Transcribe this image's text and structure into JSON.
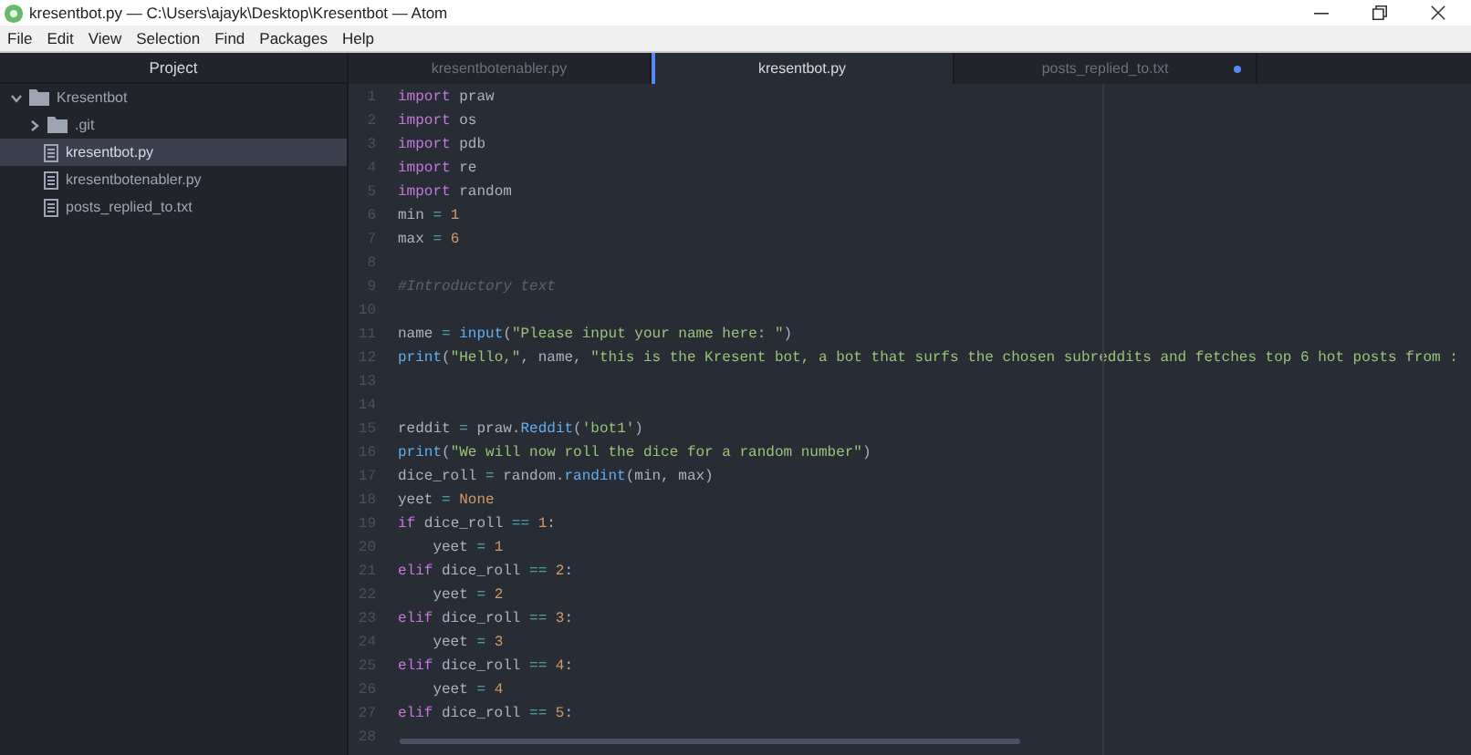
{
  "window": {
    "title": "kresentbot.py — C:\\Users\\ajayk\\Desktop\\Kresentbot — Atom"
  },
  "menu": [
    "File",
    "Edit",
    "View",
    "Selection",
    "Find",
    "Packages",
    "Help"
  ],
  "sidebar": {
    "title": "Project",
    "tree": [
      {
        "label": "Kresentbot",
        "kind": "folder",
        "expanded": true,
        "selected": false,
        "children": [
          {
            "label": ".git",
            "kind": "folder",
            "expanded": false,
            "selected": false
          },
          {
            "label": "kresentbot.py",
            "kind": "file",
            "selected": true
          },
          {
            "label": "kresentbotenabler.py",
            "kind": "file",
            "selected": false
          },
          {
            "label": "posts_replied_to.txt",
            "kind": "file",
            "selected": false
          }
        ]
      }
    ]
  },
  "tabs": [
    {
      "label": "kresentbotenabler.py",
      "selected": false,
      "modified": false
    },
    {
      "label": "kresentbot.py",
      "selected": true,
      "modified": false
    },
    {
      "label": "posts_replied_to.txt",
      "selected": false,
      "modified": true
    }
  ],
  "editor": {
    "lines": [
      {
        "number": "1",
        "tokens": [
          {
            "text": "import",
            "kind": "keyword"
          },
          {
            "text": " praw",
            "kind": "plain"
          }
        ]
      },
      {
        "number": "2",
        "tokens": [
          {
            "text": "import",
            "kind": "keyword"
          },
          {
            "text": " os",
            "kind": "plain"
          }
        ]
      },
      {
        "number": "3",
        "tokens": [
          {
            "text": "import",
            "kind": "keyword"
          },
          {
            "text": " pdb",
            "kind": "plain"
          }
        ]
      },
      {
        "number": "4",
        "tokens": [
          {
            "text": "import",
            "kind": "keyword"
          },
          {
            "text": " re",
            "kind": "plain"
          }
        ]
      },
      {
        "number": "5",
        "tokens": [
          {
            "text": "import",
            "kind": "keyword"
          },
          {
            "text": " random",
            "kind": "plain"
          }
        ]
      },
      {
        "number": "6",
        "tokens": [
          {
            "text": "min ",
            "kind": "plain"
          },
          {
            "text": "=",
            "kind": "operator"
          },
          {
            "text": " 1",
            "kind": "number"
          }
        ]
      },
      {
        "number": "7",
        "tokens": [
          {
            "text": "max ",
            "kind": "plain"
          },
          {
            "text": "=",
            "kind": "operator"
          },
          {
            "text": " 6",
            "kind": "number"
          }
        ]
      },
      {
        "number": "8"
      },
      {
        "number": "9",
        "tokens": [
          {
            "text": "#Introductory text",
            "kind": "comment"
          }
        ]
      },
      {
        "number": "10"
      },
      {
        "number": "11",
        "tokens": [
          {
            "text": "name ",
            "kind": "plain"
          },
          {
            "text": "=",
            "kind": "operator"
          },
          {
            "text": " input",
            "kind": "function"
          },
          {
            "text": "(",
            "kind": "plain"
          },
          {
            "text": "\"Please input your name here: \"",
            "kind": "string"
          },
          {
            "text": ")",
            "kind": "plain"
          }
        ]
      },
      {
        "number": "12",
        "tokens": [
          {
            "text": "print",
            "kind": "function"
          },
          {
            "text": "(",
            "kind": "plain"
          },
          {
            "text": "\"Hello,\"",
            "kind": "string"
          },
          {
            "text": ", name, ",
            "kind": "plain"
          },
          {
            "text": "\"this is the Kresent bot, a bot that surfs the chosen subreddits and fetches top 6 hot posts from :",
            "kind": "string"
          }
        ]
      },
      {
        "number": "13"
      },
      {
        "number": "14"
      },
      {
        "number": "15",
        "tokens": [
          {
            "text": "reddit ",
            "kind": "plain"
          },
          {
            "text": "=",
            "kind": "operator"
          },
          {
            "text": " praw.",
            "kind": "plain"
          },
          {
            "text": "Reddit",
            "kind": "function"
          },
          {
            "text": "(",
            "kind": "plain"
          },
          {
            "text": "'bot1'",
            "kind": "string"
          },
          {
            "text": ")",
            "kind": "plain"
          }
        ]
      },
      {
        "number": "16",
        "tokens": [
          {
            "text": "print",
            "kind": "function"
          },
          {
            "text": "(",
            "kind": "plain"
          },
          {
            "text": "\"We will now roll the dice for a random number\"",
            "kind": "string"
          },
          {
            "text": ")",
            "kind": "plain"
          }
        ]
      },
      {
        "number": "17",
        "tokens": [
          {
            "text": "dice_roll ",
            "kind": "plain"
          },
          {
            "text": "=",
            "kind": "operator"
          },
          {
            "text": " random.",
            "kind": "plain"
          },
          {
            "text": "randint",
            "kind": "function"
          },
          {
            "text": "(min, max)",
            "kind": "plain"
          }
        ]
      },
      {
        "number": "18",
        "tokens": [
          {
            "text": "yeet ",
            "kind": "plain"
          },
          {
            "text": "=",
            "kind": "operator"
          },
          {
            "text": " None",
            "kind": "number"
          }
        ]
      },
      {
        "number": "19",
        "tokens": [
          {
            "text": "if",
            "kind": "keyword"
          },
          {
            "text": " dice_roll ",
            "kind": "plain"
          },
          {
            "text": "==",
            "kind": "operator"
          },
          {
            "text": " 1",
            "kind": "number"
          },
          {
            "text": ":",
            "kind": "plain"
          }
        ]
      },
      {
        "number": "20",
        "tokens": [
          {
            "text": "    yeet ",
            "kind": "plain"
          },
          {
            "text": "=",
            "kind": "operator"
          },
          {
            "text": " 1",
            "kind": "number"
          }
        ]
      },
      {
        "number": "21",
        "tokens": [
          {
            "text": "elif",
            "kind": "keyword"
          },
          {
            "text": " dice_roll ",
            "kind": "plain"
          },
          {
            "text": "==",
            "kind": "operator"
          },
          {
            "text": " 2",
            "kind": "number"
          },
          {
            "text": ":",
            "kind": "plain"
          }
        ]
      },
      {
        "number": "22",
        "tokens": [
          {
            "text": "    yeet ",
            "kind": "plain"
          },
          {
            "text": "=",
            "kind": "operator"
          },
          {
            "text": " 2",
            "kind": "number"
          }
        ]
      },
      {
        "number": "23",
        "tokens": [
          {
            "text": "elif",
            "kind": "keyword"
          },
          {
            "text": " dice_roll ",
            "kind": "plain"
          },
          {
            "text": "==",
            "kind": "operator"
          },
          {
            "text": " 3",
            "kind": "number"
          },
          {
            "text": ":",
            "kind": "plain"
          }
        ]
      },
      {
        "number": "24",
        "tokens": [
          {
            "text": "    yeet ",
            "kind": "plain"
          },
          {
            "text": "=",
            "kind": "operator"
          },
          {
            "text": " 3",
            "kind": "number"
          }
        ]
      },
      {
        "number": "25",
        "tokens": [
          {
            "text": "elif",
            "kind": "keyword"
          },
          {
            "text": " dice_roll ",
            "kind": "plain"
          },
          {
            "text": "==",
            "kind": "operator"
          },
          {
            "text": " 4",
            "kind": "number"
          },
          {
            "text": ":",
            "kind": "plain"
          }
        ]
      },
      {
        "number": "26",
        "tokens": [
          {
            "text": "    yeet ",
            "kind": "plain"
          },
          {
            "text": "=",
            "kind": "operator"
          },
          {
            "text": " 4",
            "kind": "number"
          }
        ]
      },
      {
        "number": "27",
        "tokens": [
          {
            "text": "elif",
            "kind": "keyword"
          },
          {
            "text": " dice_roll ",
            "kind": "plain"
          },
          {
            "text": "==",
            "kind": "operator"
          },
          {
            "text": " 5",
            "kind": "number"
          },
          {
            "text": ":",
            "kind": "plain"
          }
        ]
      },
      {
        "number": "28"
      }
    ]
  }
}
